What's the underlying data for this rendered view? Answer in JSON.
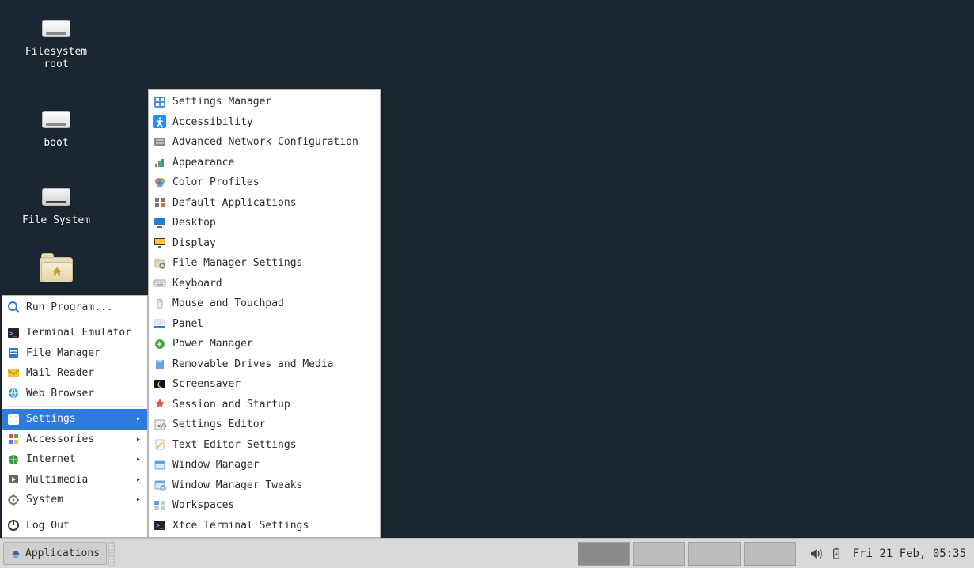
{
  "desktop": {
    "icons": [
      {
        "id": "fs-root",
        "label": "Filesystem\nroot",
        "kind": "drive"
      },
      {
        "id": "boot",
        "label": "boot",
        "kind": "drive"
      },
      {
        "id": "fs",
        "label": "File System",
        "kind": "drive-dark"
      },
      {
        "id": "home",
        "label": "",
        "kind": "folder-home"
      }
    ]
  },
  "taskbar": {
    "applications_label": "Applications",
    "workspaces_count": 4,
    "active_workspace": 0,
    "clock": "Fri 21 Feb, 05:35"
  },
  "menu": {
    "main": [
      {
        "label": "Run Program...",
        "icon": "run",
        "submenu": false
      },
      {
        "label": "Terminal Emulator",
        "icon": "terminal",
        "submenu": false
      },
      {
        "label": "File Manager",
        "icon": "files",
        "submenu": false
      },
      {
        "label": "Mail Reader",
        "icon": "mail",
        "submenu": false
      },
      {
        "label": "Web Browser",
        "icon": "globe",
        "submenu": false
      },
      {
        "label": "Settings",
        "icon": "settings",
        "submenu": true,
        "selected": true
      },
      {
        "label": "Accessories",
        "icon": "accessories",
        "submenu": true
      },
      {
        "label": "Internet",
        "icon": "internet",
        "submenu": true
      },
      {
        "label": "Multimedia",
        "icon": "multimedia",
        "submenu": true
      },
      {
        "label": "System",
        "icon": "system",
        "submenu": true
      },
      {
        "label": "Log Out",
        "icon": "logout",
        "submenu": false
      }
    ],
    "settings_sub": [
      {
        "label": "Settings Manager",
        "icon": "settings-manager"
      },
      {
        "label": "Accessibility",
        "icon": "accessibility"
      },
      {
        "label": "Advanced Network Configuration",
        "icon": "network-adv"
      },
      {
        "label": "Appearance",
        "icon": "appearance"
      },
      {
        "label": "Color Profiles",
        "icon": "color"
      },
      {
        "label": "Default Applications",
        "icon": "default-apps"
      },
      {
        "label": "Desktop",
        "icon": "desktop"
      },
      {
        "label": "Display",
        "icon": "display"
      },
      {
        "label": "File Manager Settings",
        "icon": "file-mgr-settings"
      },
      {
        "label": "Keyboard",
        "icon": "keyboard"
      },
      {
        "label": "Mouse and Touchpad",
        "icon": "mouse"
      },
      {
        "label": "Panel",
        "icon": "panel"
      },
      {
        "label": "Power Manager",
        "icon": "power"
      },
      {
        "label": "Removable Drives and Media",
        "icon": "removable"
      },
      {
        "label": "Screensaver",
        "icon": "screensaver"
      },
      {
        "label": "Session and Startup",
        "icon": "session"
      },
      {
        "label": "Settings Editor",
        "icon": "settings-editor"
      },
      {
        "label": "Text Editor Settings",
        "icon": "text-editor"
      },
      {
        "label": "Window Manager",
        "icon": "wm"
      },
      {
        "label": "Window Manager Tweaks",
        "icon": "wm-tweaks"
      },
      {
        "label": "Workspaces",
        "icon": "workspaces"
      },
      {
        "label": "Xfce Terminal Settings",
        "icon": "xfce-term"
      }
    ]
  }
}
